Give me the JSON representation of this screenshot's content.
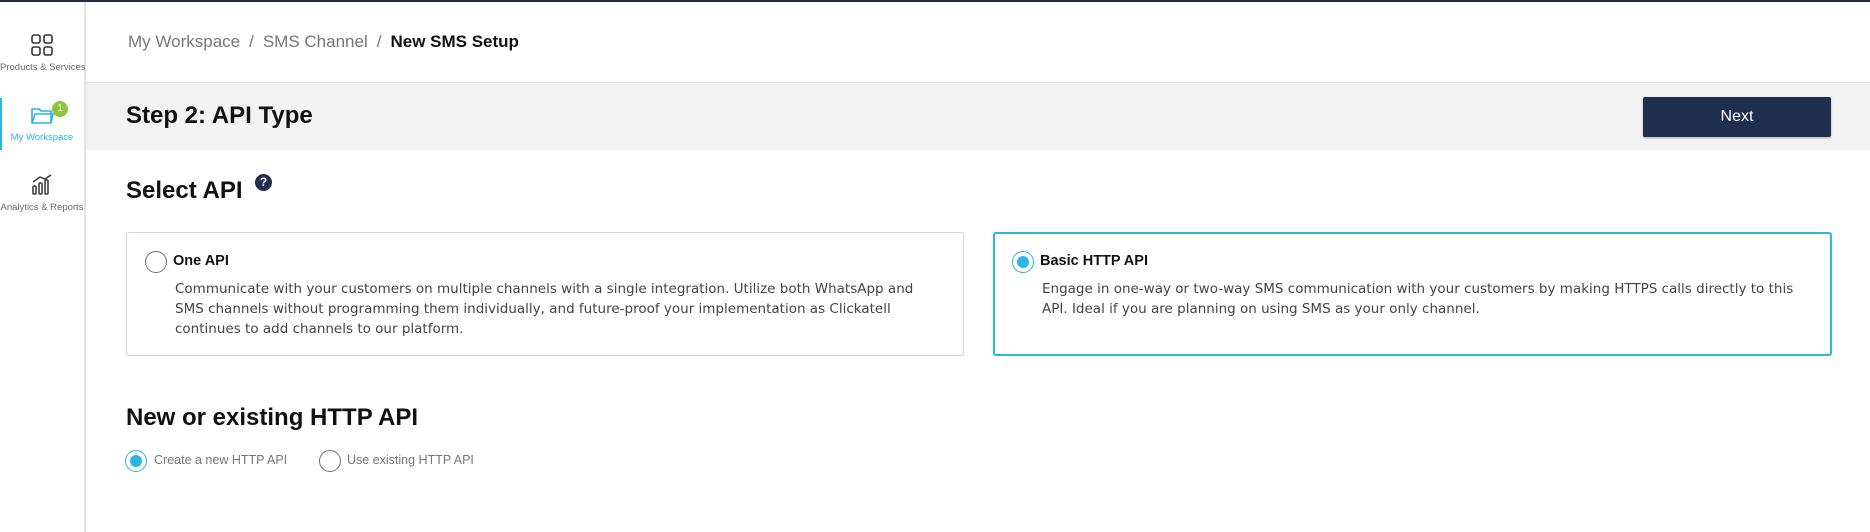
{
  "sidebar": {
    "items": [
      {
        "label": "Products & Services",
        "icon": "grid-icon"
      },
      {
        "label": "My Workspace",
        "icon": "folder-icon",
        "badge": "1",
        "active": true
      },
      {
        "label": "Analytics & Reports",
        "icon": "bar-chart-icon"
      }
    ]
  },
  "breadcrumb": {
    "items": [
      "My Workspace",
      "SMS Channel"
    ],
    "separator": "/",
    "current": "New SMS Setup"
  },
  "step": {
    "title": "Step 2: API Type",
    "next_label": "Next"
  },
  "select_api": {
    "heading": "Select API",
    "help_glyph": "?",
    "options": [
      {
        "title": "One API",
        "description": "Communicate with your customers on multiple channels with a single integration. Utilize both WhatsApp and SMS channels without programming them individually, and future-proof your implementation as Clickatell continues to add channels to our platform.",
        "selected": false
      },
      {
        "title": "Basic HTTP API",
        "description": "Engage in one-way or two-way SMS communication with your customers by making HTTPS calls directly to this API. Ideal if you are planning on using SMS as your only channel.",
        "selected": true
      }
    ]
  },
  "http_api": {
    "heading": "New or existing HTTP API",
    "options": [
      {
        "label": "Create a new HTTP API",
        "selected": true
      },
      {
        "label": "Use existing HTTP API",
        "selected": false
      }
    ]
  },
  "colors": {
    "accent": "#29b6e0",
    "navy": "#1f2d4f",
    "badge_green": "#8cc63f"
  }
}
